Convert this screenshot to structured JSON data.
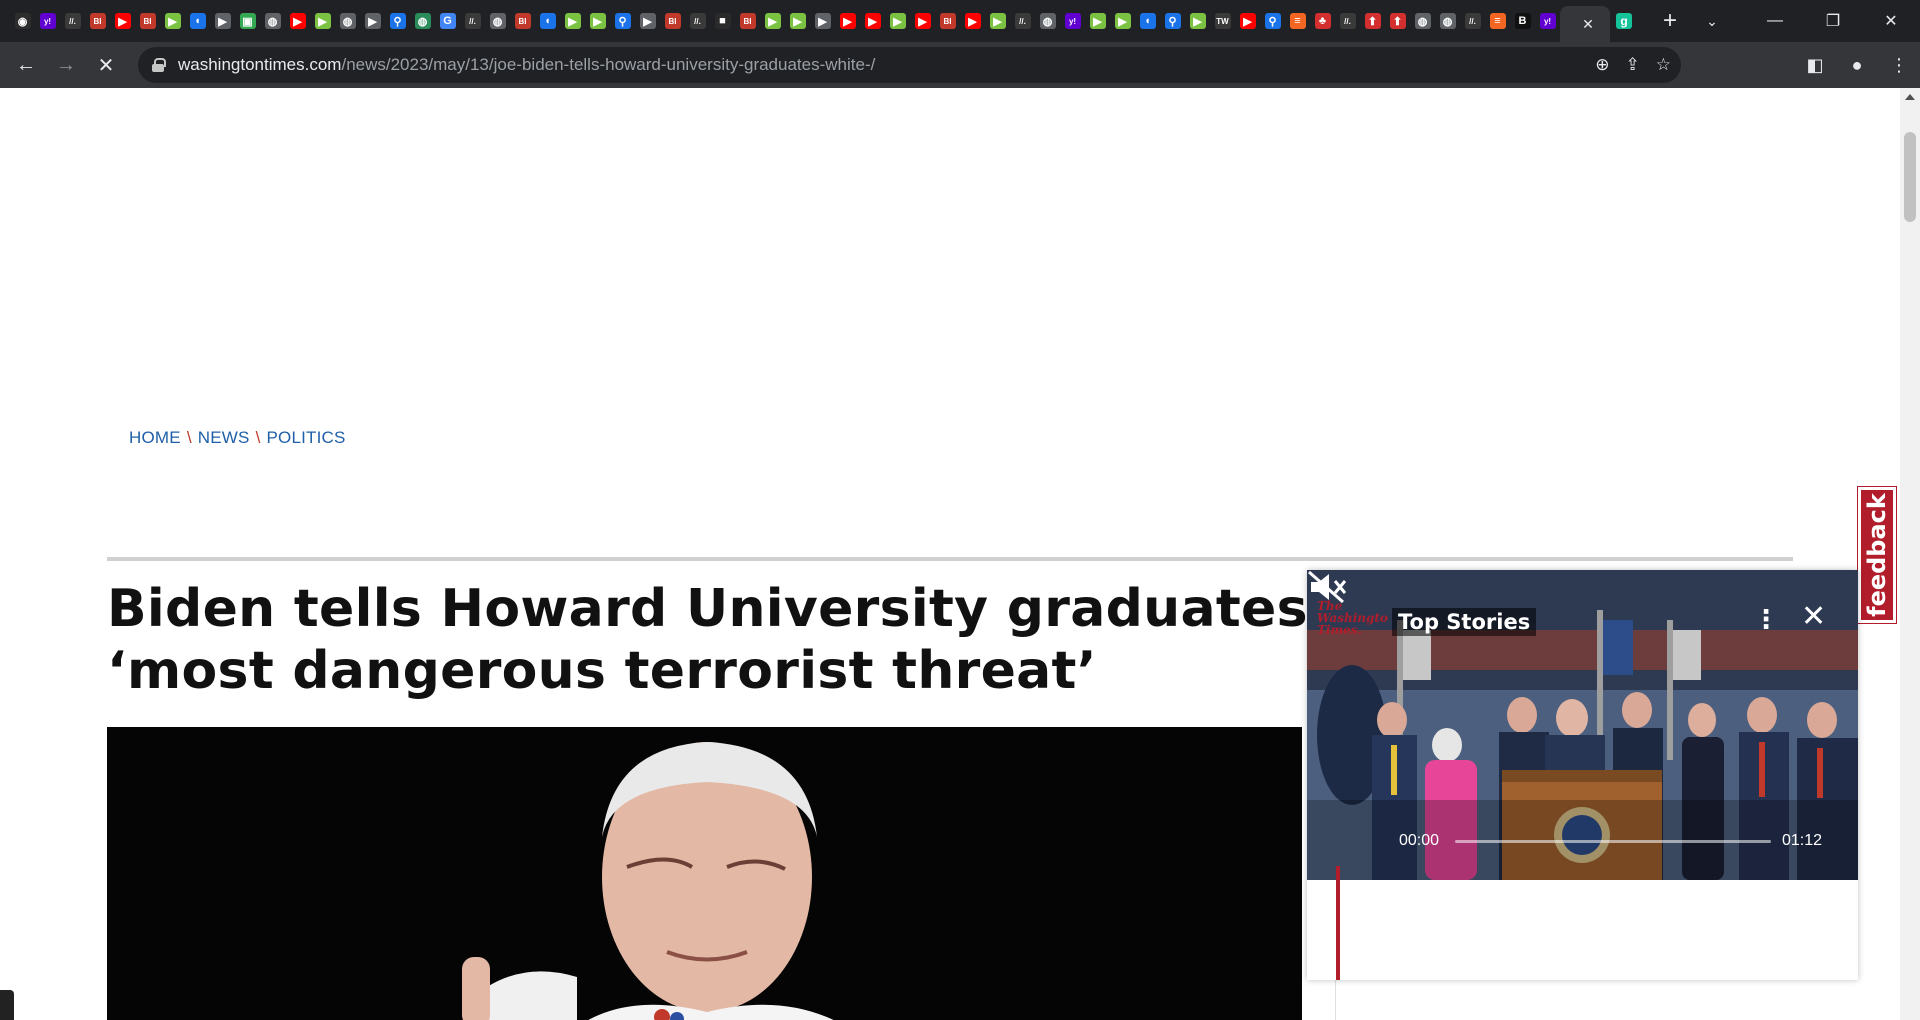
{
  "browser": {
    "tabs": [
      {
        "kind": "chrome",
        "color": "#2d2d2d",
        "glyph": "◉"
      },
      {
        "kind": "yahoo",
        "color": "#6001d2",
        "glyph": "y!"
      },
      {
        "kind": "doc",
        "color": "#3a3a3a",
        "glyph": "//."
      },
      {
        "kind": "bi",
        "color": "#c0392b",
        "glyph": "BI"
      },
      {
        "kind": "youtube",
        "color": "#ff0000",
        "glyph": "▶"
      },
      {
        "kind": "bi",
        "color": "#c0392b",
        "glyph": "BI"
      },
      {
        "kind": "play",
        "color": "#7cc242",
        "glyph": "▶"
      },
      {
        "kind": "shield",
        "color": "#1a73e8",
        "glyph": "◖"
      },
      {
        "kind": "arrow",
        "color": "#5f6368",
        "glyph": "▶"
      },
      {
        "kind": "map",
        "color": "#34a853",
        "glyph": "▣"
      },
      {
        "kind": "globe",
        "color": "#5f6368",
        "glyph": "◍"
      },
      {
        "kind": "youtube",
        "color": "#ff0000",
        "glyph": "▶"
      },
      {
        "kind": "play",
        "color": "#7cc242",
        "glyph": "▶"
      },
      {
        "kind": "globe",
        "color": "#5f6368",
        "glyph": "◍"
      },
      {
        "kind": "arrow",
        "color": "#5f6368",
        "glyph": "▶"
      },
      {
        "kind": "search",
        "color": "#1a73e8",
        "glyph": "⚲"
      },
      {
        "kind": "globe",
        "color": "#2a8c5a",
        "glyph": "◍"
      },
      {
        "kind": "google",
        "color": "#4285f4",
        "glyph": "G"
      },
      {
        "kind": "doc",
        "color": "#3a3a3a",
        "glyph": "//."
      },
      {
        "kind": "globe",
        "color": "#5f6368",
        "glyph": "◍"
      },
      {
        "kind": "bi",
        "color": "#c0392b",
        "glyph": "BI"
      },
      {
        "kind": "shield",
        "color": "#1a73e8",
        "glyph": "◖"
      },
      {
        "kind": "play",
        "color": "#7cc242",
        "glyph": "▶"
      },
      {
        "kind": "play",
        "color": "#7cc242",
        "glyph": "▶"
      },
      {
        "kind": "search",
        "color": "#1a73e8",
        "glyph": "⚲"
      },
      {
        "kind": "arrow",
        "color": "#5f6368",
        "glyph": "▶"
      },
      {
        "kind": "bi",
        "color": "#c0392b",
        "glyph": "BI"
      },
      {
        "kind": "doc",
        "color": "#3a3a3a",
        "glyph": "//."
      },
      {
        "kind": "dark",
        "color": "#2a2a2a",
        "glyph": "■"
      },
      {
        "kind": "bi",
        "color": "#c0392b",
        "glyph": "BI"
      },
      {
        "kind": "play",
        "color": "#7cc242",
        "glyph": "▶"
      },
      {
        "kind": "play",
        "color": "#7cc242",
        "glyph": "▶"
      },
      {
        "kind": "arrow",
        "color": "#5f6368",
        "glyph": "▶"
      },
      {
        "kind": "youtube",
        "color": "#ff0000",
        "glyph": "▶"
      },
      {
        "kind": "youtube",
        "color": "#ff0000",
        "glyph": "▶"
      },
      {
        "kind": "play",
        "color": "#7cc242",
        "glyph": "▶"
      },
      {
        "kind": "youtube",
        "color": "#ff0000",
        "glyph": "▶"
      },
      {
        "kind": "bi",
        "color": "#c0392b",
        "glyph": "BI"
      },
      {
        "kind": "youtube",
        "color": "#ff0000",
        "glyph": "▶"
      },
      {
        "kind": "play",
        "color": "#7cc242",
        "glyph": "▶"
      },
      {
        "kind": "doc",
        "color": "#3a3a3a",
        "glyph": "//."
      },
      {
        "kind": "globe",
        "color": "#5f6368",
        "glyph": "◍"
      },
      {
        "kind": "yahoo",
        "color": "#6001d2",
        "glyph": "y!"
      },
      {
        "kind": "play",
        "color": "#7cc242",
        "glyph": "▶"
      },
      {
        "kind": "play",
        "color": "#7cc242",
        "glyph": "▶"
      },
      {
        "kind": "shield",
        "color": "#1a73e8",
        "glyph": "◖"
      },
      {
        "kind": "search",
        "color": "#1a73e8",
        "glyph": "⚲"
      },
      {
        "kind": "play",
        "color": "#7cc242",
        "glyph": "▶"
      },
      {
        "kind": "news",
        "color": "#3a3a3a",
        "glyph": "TW"
      },
      {
        "kind": "youtube",
        "color": "#ff0000",
        "glyph": "▶"
      },
      {
        "kind": "search",
        "color": "#1a73e8",
        "glyph": "⚲"
      },
      {
        "kind": "bars",
        "color": "#f26522",
        "glyph": "≡"
      },
      {
        "kind": "leaf",
        "color": "#d32f2f",
        "glyph": "♣"
      },
      {
        "kind": "doc",
        "color": "#3a3a3a",
        "glyph": "//."
      },
      {
        "kind": "pin",
        "color": "#d32f2f",
        "glyph": "⬆"
      },
      {
        "kind": "pin",
        "color": "#d32f2f",
        "glyph": "⬆"
      },
      {
        "kind": "globe",
        "color": "#5f6368",
        "glyph": "◍"
      },
      {
        "kind": "globe",
        "color": "#5f6368",
        "glyph": "◍"
      },
      {
        "kind": "doc",
        "color": "#3a3a3a",
        "glyph": "//."
      },
      {
        "kind": "bars",
        "color": "#f26522",
        "glyph": "≡"
      },
      {
        "kind": "b",
        "color": "#111111",
        "glyph": "B"
      },
      {
        "kind": "yahoo",
        "color": "#6001d2",
        "glyph": "y!"
      }
    ],
    "active_tab": {
      "kind": "grammarly",
      "color": "#15c39a",
      "glyph": "g"
    },
    "url_host": "washingtontimes.com",
    "url_path": "/news/2023/may/13/joe-biden-tells-howard-university-graduates-white-/"
  },
  "article": {
    "breadcrumb": [
      "HOME",
      "NEWS",
      "POLITICS"
    ],
    "breadcrumb_sep": "\\",
    "headline_line1": "Biden tells Howard University graduates wh",
    "headline_line2": "‘most dangerous terrorist threat’"
  },
  "feedback_label": "feedback",
  "player": {
    "logo_line1": "The",
    "logo_line2": "Washingto",
    "logo_line3": "Times.",
    "title": "Top Stories",
    "time_current": "00:00",
    "time_duration": "01:12",
    "progress": 0
  }
}
